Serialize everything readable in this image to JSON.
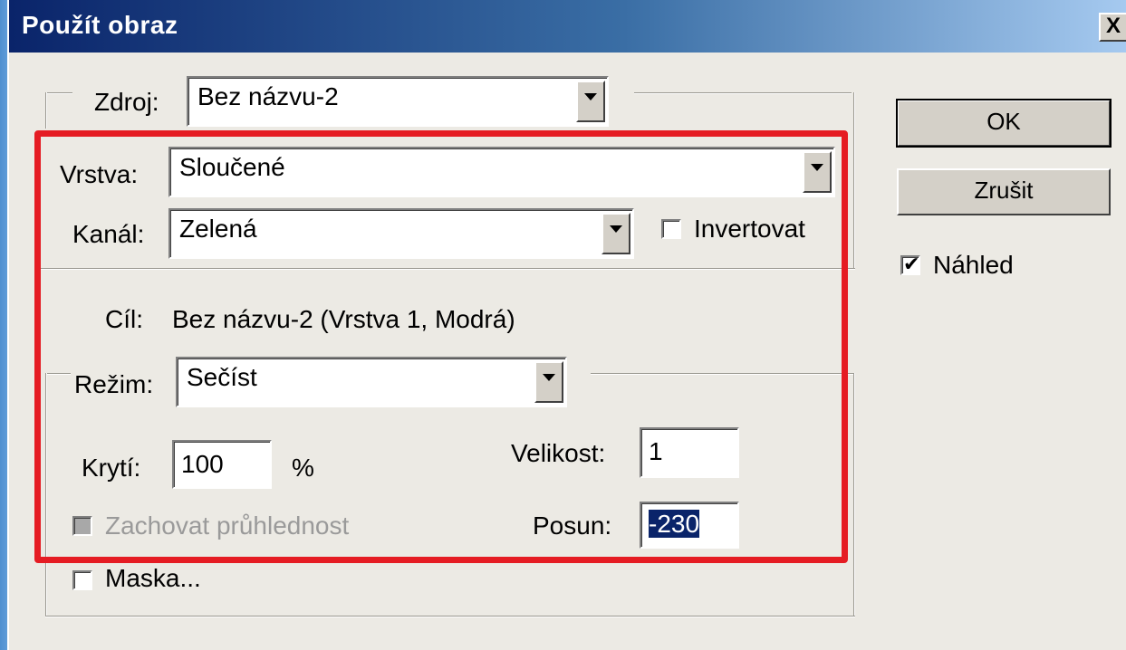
{
  "dialog": {
    "title": "Použít obraz",
    "close_glyph": "X"
  },
  "source": {
    "label": "Zdroj:",
    "value": "Bez názvu-2"
  },
  "layer": {
    "label": "Vrstva:",
    "value": "Sloučené"
  },
  "channel": {
    "label": "Kanál:",
    "value": "Zelená",
    "invert_label": "Invertovat",
    "invert_checked": false
  },
  "target": {
    "label": "Cíl:",
    "value": "Bez názvu-2 (Vrstva 1, Modrá)"
  },
  "blending": {
    "mode_label": "Režim:",
    "mode_value": "Sečíst",
    "opacity_label": "Krytí:",
    "opacity_value": "100",
    "opacity_unit": "%",
    "preserve_transparency_label": "Zachovat průhlednost",
    "preserve_transparency_disabled": true,
    "scale_label": "Velikost:",
    "scale_value": "1",
    "offset_label": "Posun:",
    "offset_value": "-230",
    "mask_label": "Maska...",
    "mask_checked": false
  },
  "buttons": {
    "ok_label": "OK",
    "cancel_label": "Zrušit"
  },
  "preview": {
    "label": "Náhled",
    "checked": true,
    "check_glyph": "✔"
  },
  "colors": {
    "highlight_frame": "#e51c23",
    "selection": "#0a246a"
  }
}
